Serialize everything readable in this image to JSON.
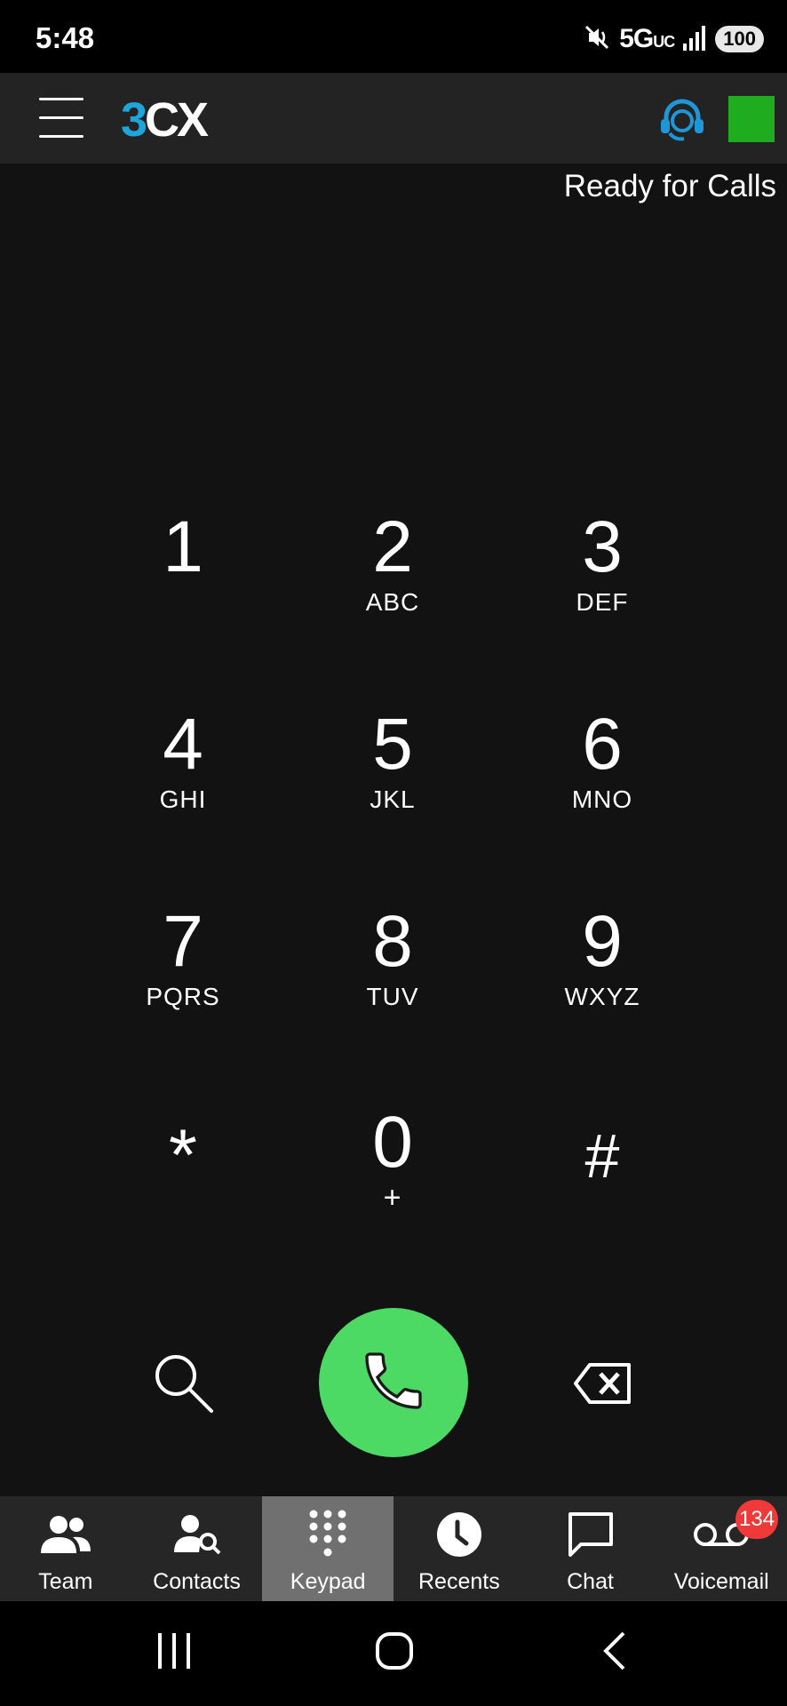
{
  "status_bar": {
    "time": "5:48",
    "network_label": "5G",
    "network_suffix": "UC",
    "battery": "100"
  },
  "app_bar": {
    "logo_part1": "3",
    "logo_part2": "CX",
    "presence_color": "#1fad1f"
  },
  "status_label": "Ready for Calls",
  "keypad": {
    "keys": [
      {
        "digit": "1",
        "letters": ""
      },
      {
        "digit": "2",
        "letters": "ABC"
      },
      {
        "digit": "3",
        "letters": "DEF"
      },
      {
        "digit": "4",
        "letters": "GHI"
      },
      {
        "digit": "5",
        "letters": "JKL"
      },
      {
        "digit": "6",
        "letters": "MNO"
      },
      {
        "digit": "7",
        "letters": "PQRS"
      },
      {
        "digit": "8",
        "letters": "TUV"
      },
      {
        "digit": "9",
        "letters": "WXYZ"
      },
      {
        "digit": "*",
        "letters": ""
      },
      {
        "digit": "0",
        "letters": "+"
      },
      {
        "digit": "#",
        "letters": ""
      }
    ]
  },
  "actions": {
    "call_color": "#4cd964"
  },
  "bottom_nav": {
    "items": [
      {
        "label": "Team",
        "icon": "team-icon"
      },
      {
        "label": "Contacts",
        "icon": "contacts-search-icon"
      },
      {
        "label": "Keypad",
        "icon": "keypad-icon",
        "active": true
      },
      {
        "label": "Recents",
        "icon": "clock-icon"
      },
      {
        "label": "Chat",
        "icon": "chat-bubble-icon"
      },
      {
        "label": "Voicemail",
        "icon": "voicemail-icon",
        "badge": "134"
      }
    ]
  }
}
